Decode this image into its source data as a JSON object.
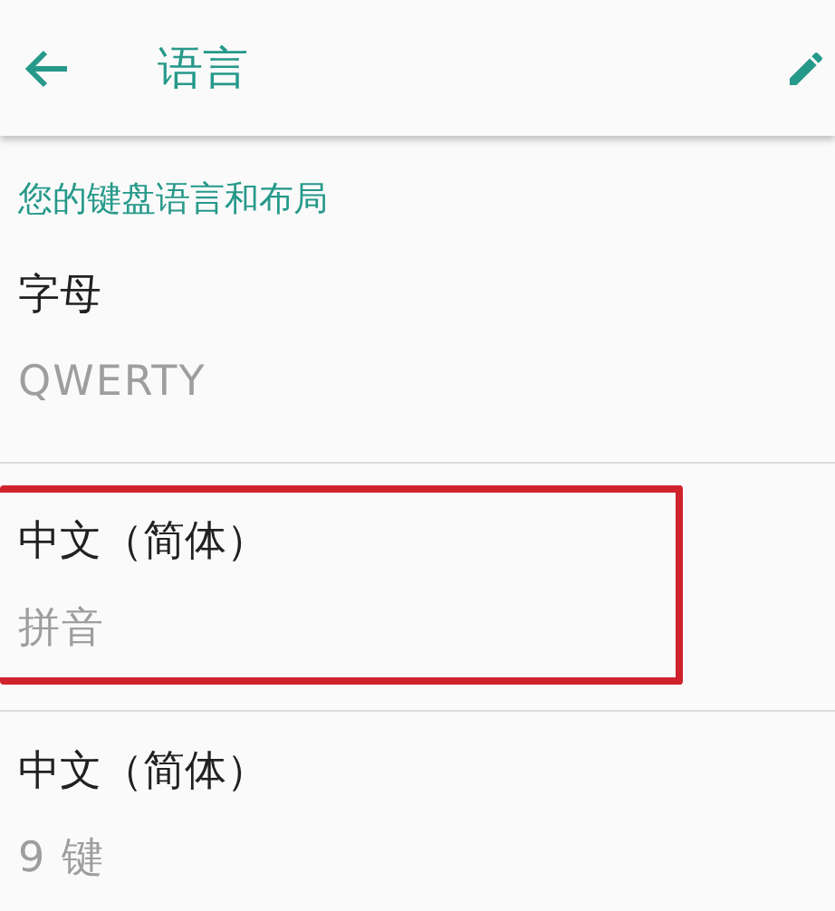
{
  "app_bar": {
    "title": "语言"
  },
  "section": {
    "title": "您的键盘语言和布局"
  },
  "items": [
    {
      "title": "字母",
      "subtitle": "QWERTY",
      "highlighted": false
    },
    {
      "title": "中文（简体）",
      "subtitle": "拼音",
      "highlighted": true
    },
    {
      "title": "中文（简体）",
      "subtitle": "9 键",
      "highlighted": false
    }
  ]
}
